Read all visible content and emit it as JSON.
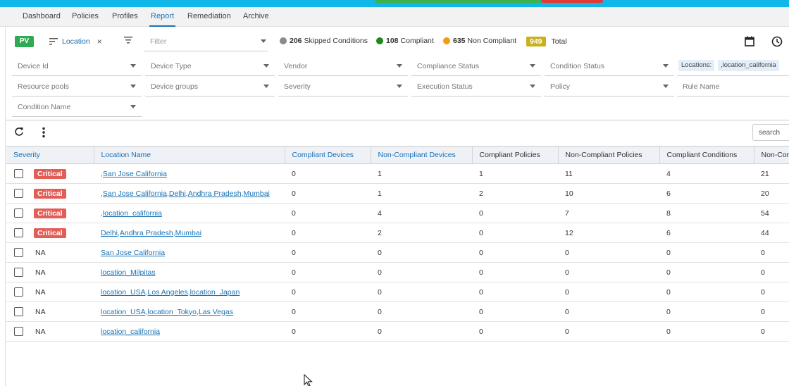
{
  "nav": {
    "tabs": [
      {
        "label": "Dashboard",
        "active": false
      },
      {
        "label": "Policies",
        "active": false
      },
      {
        "label": "Profiles",
        "active": false
      },
      {
        "label": "Report",
        "active": true
      },
      {
        "label": "Remediation",
        "active": false
      },
      {
        "label": "Archive",
        "active": false
      }
    ]
  },
  "toolbar": {
    "pv_label": "PV",
    "group_by_label": "Location",
    "group_by_remove": "×",
    "filter_placeholder": "Filter"
  },
  "stats": {
    "skipped": {
      "count": "206",
      "label": "Skipped Conditions",
      "color": "#8a8a8a"
    },
    "compliant": {
      "count": "108",
      "label": "Compliant",
      "color": "#2e8b2e"
    },
    "non_compliant": {
      "count": "635",
      "label": "Non Compliant",
      "color": "#f39c12"
    },
    "total": {
      "count": "949",
      "label": "Total",
      "color": "#c9b11a"
    }
  },
  "filters": {
    "device_id": "Device Id",
    "device_type": "Device Type",
    "vendor": "Vendor",
    "compliance_status": "Compliance Status",
    "condition_status": "Condition Status",
    "resource_pools": "Resource pools",
    "device_groups": "Device groups",
    "severity": "Severity",
    "execution_status": "Execution Status",
    "policy": "Policy",
    "rule_name": "Rule Name",
    "condition_name": "Condition Name",
    "locations_chip_label": "Locations:",
    "locations_chip_value": ",location_california"
  },
  "search_placeholder": "search",
  "table": {
    "headers": {
      "severity": "Severity",
      "location_name": "Location Name",
      "compliant_devices": "Compliant Devices",
      "non_compliant_devices": "Non-Compliant Devices",
      "compliant_policies": "Compliant Policies",
      "non_compliant_policies": "Non-Compliant Policies",
      "compliant_conditions": "Compliant Conditions",
      "non_compliant_conditions": "Non-Com"
    },
    "rows": [
      {
        "severity": "Critical",
        "location": ",San Jose California",
        "cd": "0",
        "ncd": "1",
        "cp": "1",
        "ncp": "11",
        "cc": "4",
        "ncc": "21"
      },
      {
        "severity": "Critical",
        "location": ",San Jose California,Delhi,Andhra Pradesh,Mumbai",
        "cd": "0",
        "ncd": "1",
        "cp": "2",
        "ncp": "10",
        "cc": "6",
        "ncc": "20"
      },
      {
        "severity": "Critical",
        "location": ",location_california",
        "cd": "0",
        "ncd": "4",
        "cp": "0",
        "ncp": "7",
        "cc": "8",
        "ncc": "54"
      },
      {
        "severity": "Critical",
        "location": "Delhi,Andhra Pradesh,Mumbai",
        "cd": "0",
        "ncd": "2",
        "cp": "0",
        "ncp": "12",
        "cc": "6",
        "ncc": "44"
      },
      {
        "severity": "NA",
        "location": "San Jose California",
        "cd": "0",
        "ncd": "0",
        "cp": "0",
        "ncp": "0",
        "cc": "0",
        "ncc": "0"
      },
      {
        "severity": "NA",
        "location": "location_Milpitas",
        "cd": "0",
        "ncd": "0",
        "cp": "0",
        "ncp": "0",
        "cc": "0",
        "ncc": "0"
      },
      {
        "severity": "NA",
        "location": "location_USA,Los Angeles,location_Japan",
        "cd": "0",
        "ncd": "0",
        "cp": "0",
        "ncp": "0",
        "cc": "0",
        "ncc": "0"
      },
      {
        "severity": "NA",
        "location": "location_USA,location_Tokyo,Las Vegas",
        "cd": "0",
        "ncd": "0",
        "cp": "0",
        "ncp": "0",
        "cc": "0",
        "ncc": "0"
      },
      {
        "severity": "NA",
        "location": "location_california",
        "cd": "0",
        "ncd": "0",
        "cp": "0",
        "ncp": "0",
        "cc": "0",
        "ncc": "0"
      }
    ]
  }
}
